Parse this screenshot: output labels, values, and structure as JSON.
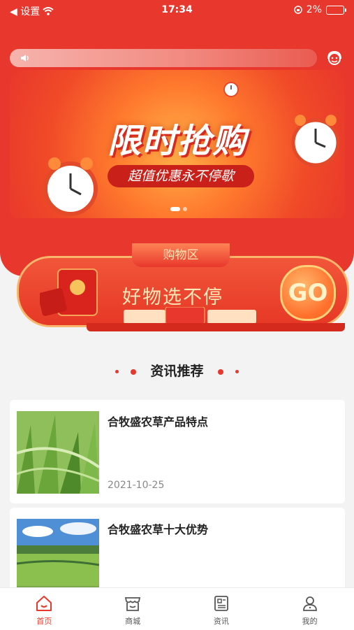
{
  "status_bar": {
    "back_label": "◀ 设置",
    "time": "17:34",
    "battery": "2%"
  },
  "icons": {
    "notice": "speaker-icon",
    "service": "customer-service-icon"
  },
  "banner": {
    "title": "限时抢购",
    "subtitle": "超值优惠永不停歇"
  },
  "shop_entry": {
    "tag": "购物区",
    "slogan": "好物选不停",
    "go_label": "GO"
  },
  "news": {
    "section_title": "资讯推荐",
    "items": [
      {
        "title": "合牧盛农草产品特点",
        "date": "2021-10-25"
      },
      {
        "title": "合牧盛农草十大优势",
        "date": ""
      }
    ]
  },
  "tab_bar": [
    {
      "label": "首页",
      "icon": "home-icon"
    },
    {
      "label": "商城",
      "icon": "shop-icon"
    },
    {
      "label": "资讯",
      "icon": "news-icon"
    },
    {
      "label": "我的",
      "icon": "profile-icon"
    }
  ],
  "colors": {
    "primary_red": "#e8372c",
    "gold": "#ffe7b8"
  }
}
